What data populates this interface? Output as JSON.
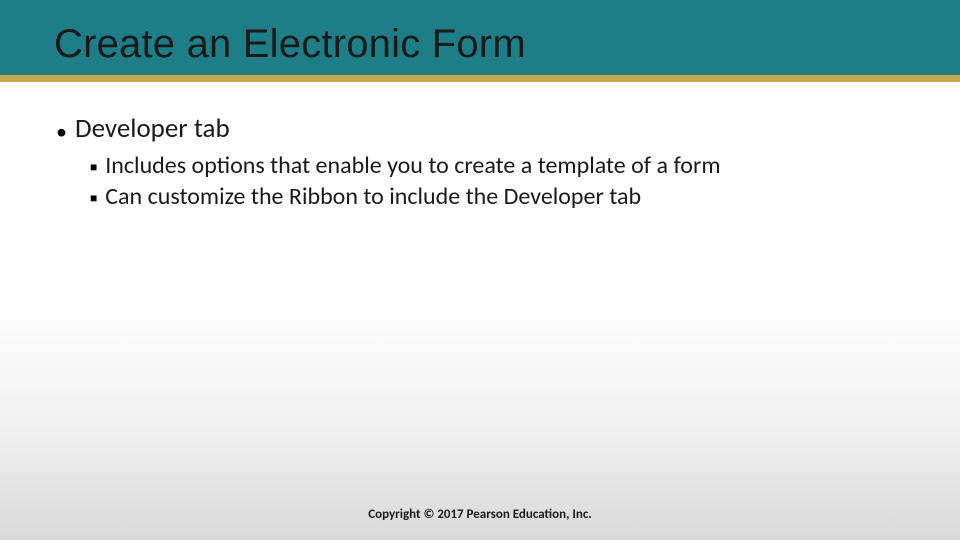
{
  "title": "Create an Electronic Form",
  "bullets": {
    "lvl1_0": "Developer tab",
    "lvl2_0": "Includes options that enable you to create a template of a form",
    "lvl2_1": "Can customize the Ribbon to include the Developer tab"
  },
  "footer": "Copyright © 2017 Pearson Education, Inc.",
  "colors": {
    "header_band": "#1e7e88",
    "underline": "#c5a94a"
  }
}
